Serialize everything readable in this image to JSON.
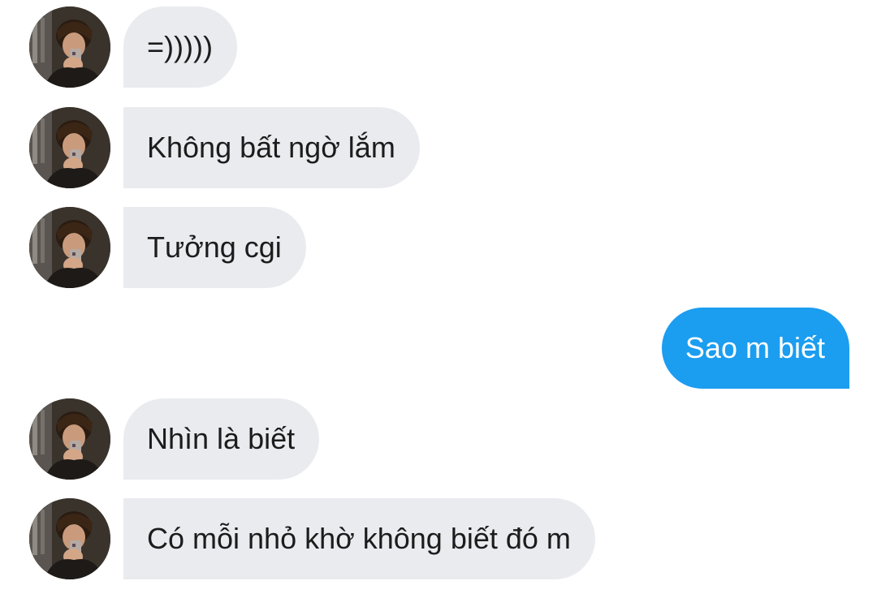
{
  "colors": {
    "incoming_bubble": "#e9ebef",
    "outgoing_bubble": "#1b9df0",
    "incoming_text": "#1c1c1c",
    "outgoing_text": "#ffffff"
  },
  "messages": [
    {
      "sender": "them",
      "text": "=)))))"
    },
    {
      "sender": "them",
      "text": "Không bất ngờ lắm"
    },
    {
      "sender": "them",
      "text": "Tưởng cgi"
    },
    {
      "sender": "me",
      "text": "Sao m biết"
    },
    {
      "sender": "them",
      "text": "Nhìn là biết"
    },
    {
      "sender": "them",
      "text": "Có mỗi nhỏ khờ không biết đó m"
    }
  ],
  "avatar": {
    "icon": "contact-avatar-photo"
  }
}
